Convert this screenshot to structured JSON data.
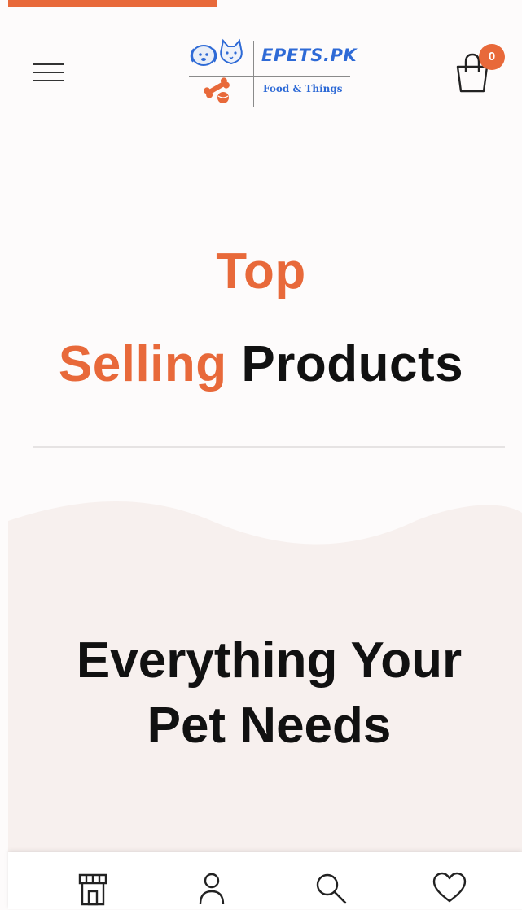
{
  "header": {
    "brand_name": "EPETS.PK",
    "brand_tagline": "Food & Things",
    "cart_count": "0",
    "icons": [
      "hamburger-menu-icon",
      "pets-logo-icon",
      "shopping-bag-icon"
    ]
  },
  "section": {
    "title_line1": "Top",
    "title_line2_accent": "Selling",
    "title_line2_dark": "Products"
  },
  "hero": {
    "title_line1": "Everything Your",
    "title_line2": "Pet Needs"
  },
  "bottom_nav": {
    "items": [
      "store-icon",
      "user-icon",
      "search-icon",
      "heart-icon"
    ]
  },
  "colors": {
    "accent": "#e8693a",
    "brand_blue": "#2e6ad6",
    "hero_background": "#f7f0ee",
    "text_dark": "#111111"
  }
}
